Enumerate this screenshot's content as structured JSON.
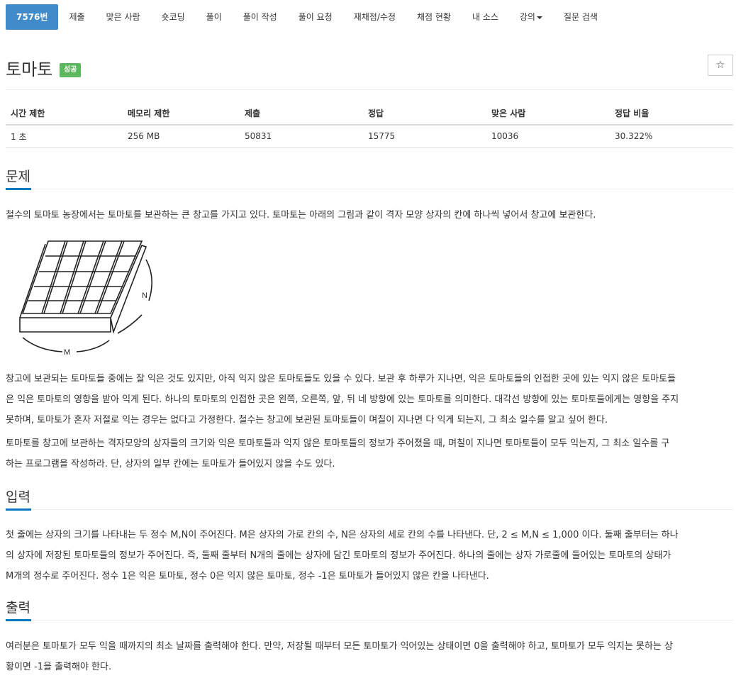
{
  "tabs": [
    {
      "label": "7576번",
      "active": true
    },
    {
      "label": "제출"
    },
    {
      "label": "맞은 사람"
    },
    {
      "label": "숏코딩"
    },
    {
      "label": "풀이"
    },
    {
      "label": "풀이 작성"
    },
    {
      "label": "풀이 요청"
    },
    {
      "label": "재채점/수정"
    },
    {
      "label": "채점 현황"
    },
    {
      "label": "내 소스"
    },
    {
      "label": "강의",
      "dropdown": true
    },
    {
      "label": "질문 검색"
    }
  ],
  "problem": {
    "title": "토마토",
    "status_badge": "성공",
    "star_icon": "☆"
  },
  "info_table": {
    "headers": [
      "시간 제한",
      "메모리 제한",
      "제출",
      "정답",
      "맞은 사람",
      "정답 비율"
    ],
    "values": [
      "1 초",
      "256 MB",
      "50831",
      "15775",
      "10036",
      "30.322%"
    ]
  },
  "sections": {
    "problem": {
      "heading": "문제",
      "p1": "철수의 토마토 농장에서는 토마토를 보관하는 큰 창고를 가지고 있다. 토마토는 아래의 그림과 같이 격자 모양 상자의 칸에 하나씩 넣어서 창고에 보관한다.",
      "figure_label_n": "N",
      "figure_label_m": "M",
      "p2_lines": [
        "창고에 보관되는 토마토들 중에는 잘 익은 것도 있지만, 아직 익지 않은 토마토들도 있을 수 있다. 보관 후 하루가 지나면, 익은 토마토들의 인접한 곳에 있는 익지 않은 토마토들",
        "은 익은 토마토의 영향을 받아 익게 된다. 하나의 토마토의 인접한 곳은 왼쪽, 오른쪽, 앞, 뒤 네 방향에 있는 토마토를 의미한다. 대각선 방향에 있는 토마토들에게는 영향을 주지",
        "못하며, 토마토가 혼자 저절로 익는 경우는 없다고 가정한다. 철수는 창고에 보관된 토마토들이 며칠이 지나면 다 익게 되는지, 그 최소 일수를 알고 싶어 한다."
      ],
      "p3_lines": [
        "토마토를 창고에 보관하는 격자모양의 상자들의 크기와 익은 토마토들과 익지 않은 토마토들의 정보가 주어졌을 때, 며칠이 지나면 토마토들이 모두 익는지, 그 최소 일수를 구",
        "하는 프로그램을 작성하라. 단, 상자의 일부 칸에는 토마토가 들어있지 않을 수도 있다."
      ]
    },
    "input": {
      "heading": "입력",
      "lines": [
        "첫 줄에는 상자의 크기를 나타내는 두 정수 M,N이 주어진다. M은 상자의 가로 칸의 수, N은 상자의 세로 칸의 수를 나타낸다. 단, 2 ≤ M,N ≤ 1,000 이다. 둘째 줄부터는 하나",
        "의 상자에 저장된 토마토들의 정보가 주어진다. 즉, 둘째 줄부터 N개의 줄에는 상자에 담긴 토마토의 정보가 주어진다. 하나의 줄에는 상자 가로줄에 들어있는 토마토의 상태가",
        "M개의 정수로 주어진다. 정수 1은 익은 토마토, 정수 0은 익지 않은 토마토, 정수 -1은 토마토가 들어있지 않은 칸을 나타낸다."
      ]
    },
    "output": {
      "heading": "출력",
      "lines": [
        "여러분은 토마토가 모두 익을 때까지의 최소 날짜를 출력해야 한다. 만약, 저장될 때부터 모든 토마토가 익어있는 상태이면 0을 출력해야 하고, 토마토가 모두 익지는 못하는 상",
        "황이면 -1을 출력해야 한다."
      ]
    }
  },
  "colors": {
    "active_tab": "#428bca",
    "success_badge": "#5cb85c",
    "section_marker": "#0076c0"
  }
}
